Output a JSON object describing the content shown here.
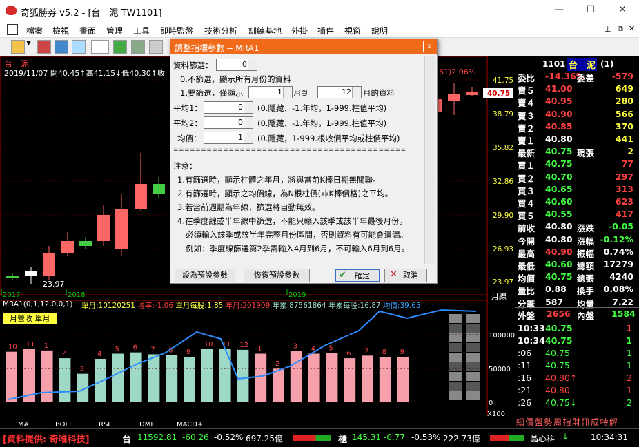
{
  "window": {
    "title": "奇狐勝券 v5.2 - [台　泥 TW1101]"
  },
  "menu": [
    "檔案",
    "檢視",
    "畫面",
    "管理",
    "工具",
    "即時監盤",
    "技術分析",
    "訓練基地",
    "外掛",
    "插件",
    "視窗",
    "說明"
  ],
  "chart_header": {
    "name": "台　泥",
    "info": "2019/11/07 開40.45↑高41.15↓低40.30↑收",
    "right_info": "61)2.06%"
  },
  "price_axis": [
    "41.75",
    "40.75",
    "38.79",
    "35.82",
    "32.86",
    "29.90",
    "26.93",
    "23.97"
  ],
  "price_axis_unit": "月線",
  "year_labels": [
    "2017",
    "2018",
    "2019"
  ],
  "low_label": "23.97",
  "indicator_header": {
    "name": "MRA1(0,1,12,0,0,1)",
    "items": [
      "單月:10120251",
      "增率:-1.06",
      "單月每股:1.85",
      "年月:201909",
      "年累:87561864",
      "年累每股:16.87",
      "均價:39.65"
    ]
  },
  "indicator_legend": "月營收 單月",
  "indicator_axis": [
    "100000",
    "50000",
    "0"
  ],
  "indicator_unit": "X100",
  "indicator_months": [
    "10",
    "11",
    "1",
    "2",
    "3",
    "4",
    "5",
    "6",
    "7",
    "8",
    "9",
    "10",
    "11",
    "12",
    "1",
    "2",
    "3",
    "4",
    "5",
    "6",
    "7",
    "8",
    "9"
  ],
  "indicator_values": [
    78,
    82,
    80,
    68,
    44,
    67,
    75,
    77,
    74,
    73,
    70,
    82,
    82,
    81,
    75,
    52,
    79,
    75,
    76,
    68,
    72,
    70,
    70
  ],
  "tabs": [
    "MA",
    "BOLL",
    "RSI",
    "DMI",
    "MACD+"
  ],
  "dialog": {
    "title": "調整指標參數 -- MRA1",
    "close": "x",
    "filter_label": "資料篩選：",
    "filter_value": "0",
    "opt0": "0.不篩選，顯示所有月份的資料",
    "opt1a": "1.要篩選，僅顯示",
    "opt1_from": "1",
    "opt1b": "月到",
    "opt1_to": "12",
    "opt1c": "月的資料",
    "avg1_label": "平均1：",
    "avg1_value": "0",
    "avg1_desc": "(0.隱藏、-1.年均，1-999.柱值平均)",
    "avg2_label": "平均2：",
    "avg2_value": "0",
    "avg2_desc": "(0.隱藏、-1.年均，1-999.柱值平均)",
    "price_label": "均價：",
    "price_value": "1",
    "price_desc": "(0.隱藏，1-999.根收價平均或柱價平均)",
    "divider": "==========================================",
    "notes_title": "注意：",
    "note1": "1.有篩選時，顯示柱體之年月，將與當前K棒日期無關聯。",
    "note2": "2.有篩選時，顯示之均價線，為N根柱價(非K棒價格)之平均。",
    "note3": "3.若當前週期為年線，篩選將自動無效。",
    "note4": "4.在季度線或半年線中篩選，不能只輸入該季或該半年最後月份。",
    "note5": "必須輸入該季或該半年完整月份區間，否則資料有可能會遺漏。",
    "note6": "例如：季度線篩選第2季需輸入4月到6月，不可輸入6月到6月。",
    "btn_default_set": "設為預設參數",
    "btn_default_restore": "恢復預設參數",
    "btn_ok": "確定",
    "btn_cancel": "取消"
  },
  "quote": {
    "code": "1101",
    "name": "台　泥",
    "name_suffix": "(1)",
    "rows": [
      {
        "l": "委比",
        "v": "-14.36%",
        "l2": "委差",
        "v2": "-579",
        "c": "#ff4040",
        "c2": "#ff4040"
      },
      {
        "l": "賣５",
        "v": "41.00",
        "l2": "",
        "v2": "649",
        "c": "#ff4040",
        "c2": "#ffff40"
      },
      {
        "l": "賣４",
        "v": "40.95",
        "l2": "",
        "v2": "280",
        "c": "#ff4040",
        "c2": "#ffff40"
      },
      {
        "l": "賣３",
        "v": "40.90",
        "l2": "",
        "v2": "566",
        "c": "#ff4040",
        "c2": "#ffff40"
      },
      {
        "l": "賣２",
        "v": "40.85",
        "l2": "",
        "v2": "370",
        "c": "#ff4040",
        "c2": "#ffff40"
      },
      {
        "l": "賣１",
        "v": "40.80",
        "l2": "",
        "v2": "441",
        "c": "#ffffff",
        "c2": "#ffff40"
      },
      {
        "l": "最新",
        "v": "40.75",
        "l2": "現張",
        "v2": "2",
        "c": "#40ff40",
        "c2": "#ffff40"
      },
      {
        "l": "買１",
        "v": "40.75",
        "l2": "",
        "v2": "77",
        "c": "#40ff40",
        "c2": "#ff4040"
      },
      {
        "l": "買２",
        "v": "40.70",
        "l2": "",
        "v2": "297",
        "c": "#40ff40",
        "c2": "#ff4040"
      },
      {
        "l": "買３",
        "v": "40.65",
        "l2": "",
        "v2": "313",
        "c": "#40ff40",
        "c2": "#ff4040"
      },
      {
        "l": "買４",
        "v": "40.60",
        "l2": "",
        "v2": "623",
        "c": "#40ff40",
        "c2": "#ff4040"
      },
      {
        "l": "買５",
        "v": "40.55",
        "l2": "",
        "v2": "417",
        "c": "#40ff40",
        "c2": "#ff4040"
      },
      {
        "l": "前收",
        "v": "40.80",
        "l2": "漲跌",
        "v2": "-0.05",
        "c": "#ffffff",
        "c2": "#40ff40"
      },
      {
        "l": "今開",
        "v": "40.80",
        "l2": "漲幅",
        "v2": "-0.12%",
        "c": "#ffffff",
        "c2": "#40ff40"
      },
      {
        "l": "最高",
        "v": "40.90",
        "l2": "振幅",
        "v2": "0.74%",
        "c": "#ff4040",
        "c2": "#ffffff"
      },
      {
        "l": "最低",
        "v": "40.60",
        "l2": "總額",
        "v2": "17279",
        "c": "#40ff40",
        "c2": "#ffffff"
      },
      {
        "l": "均價",
        "v": "40.75",
        "l2": "總張",
        "v2": "4240",
        "c": "#40ff40",
        "c2": "#ffffff"
      },
      {
        "l": "量比",
        "v": "0.88",
        "l2": "換手",
        "v2": "0.08%",
        "c": "#ffffff",
        "c2": "#ffffff"
      },
      {
        "l": "分筆",
        "v": "587",
        "l2": "均量",
        "v2": "7.22",
        "c": "#ffffff",
        "c2": "#ffffff"
      }
    ],
    "outer_label": "外盤",
    "outer_value": "2656",
    "inner_label": "內盤",
    "inner_value": "1584",
    "ticks": [
      {
        "t": "10:33",
        "p": "40.75",
        "v": "1",
        "c": "#40ff40",
        "vc": "#ff4040"
      },
      {
        "t": "10:34",
        "p": "40.75",
        "v": "1",
        "c": "#40ff40",
        "vc": "#40ff40"
      },
      {
        "t": ":06",
        "p": "40.75",
        "v": "1",
        "c": "#40ff40",
        "vc": "#40ff40"
      },
      {
        "t": ":11",
        "p": "40.75",
        "v": "1",
        "c": "#40ff40",
        "vc": "#40ff40"
      },
      {
        "t": ":16",
        "p": "40.80↑",
        "v": "2",
        "c": "#ff4040",
        "vc": "#ff4040"
      },
      {
        "t": ":21",
        "p": "40.80",
        "v": "1",
        "c": "#ff4040",
        "vc": "#ff4040"
      },
      {
        "t": ":26",
        "p": "40.75↓",
        "v": "2",
        "c": "#40ff40",
        "vc": "#40ff40"
      }
    ],
    "bottom_tabs": "細價盤勢周指財訊成特解"
  },
  "status": {
    "provider": "[資料提供: 奇唯科技]",
    "taiex_label": "台",
    "taiex": "11592.81",
    "taiex_chg": "-60.26",
    "taiex_pct": "-0.52%",
    "taiex_amt": "697.25億",
    "otc_label": "櫃",
    "otc": "145.31",
    "otc_chg": "-0.77",
    "otc_pct": "-0.53%",
    "otc_amt": "222.73億",
    "stock": "晶心科",
    "time": "10:34:31"
  }
}
